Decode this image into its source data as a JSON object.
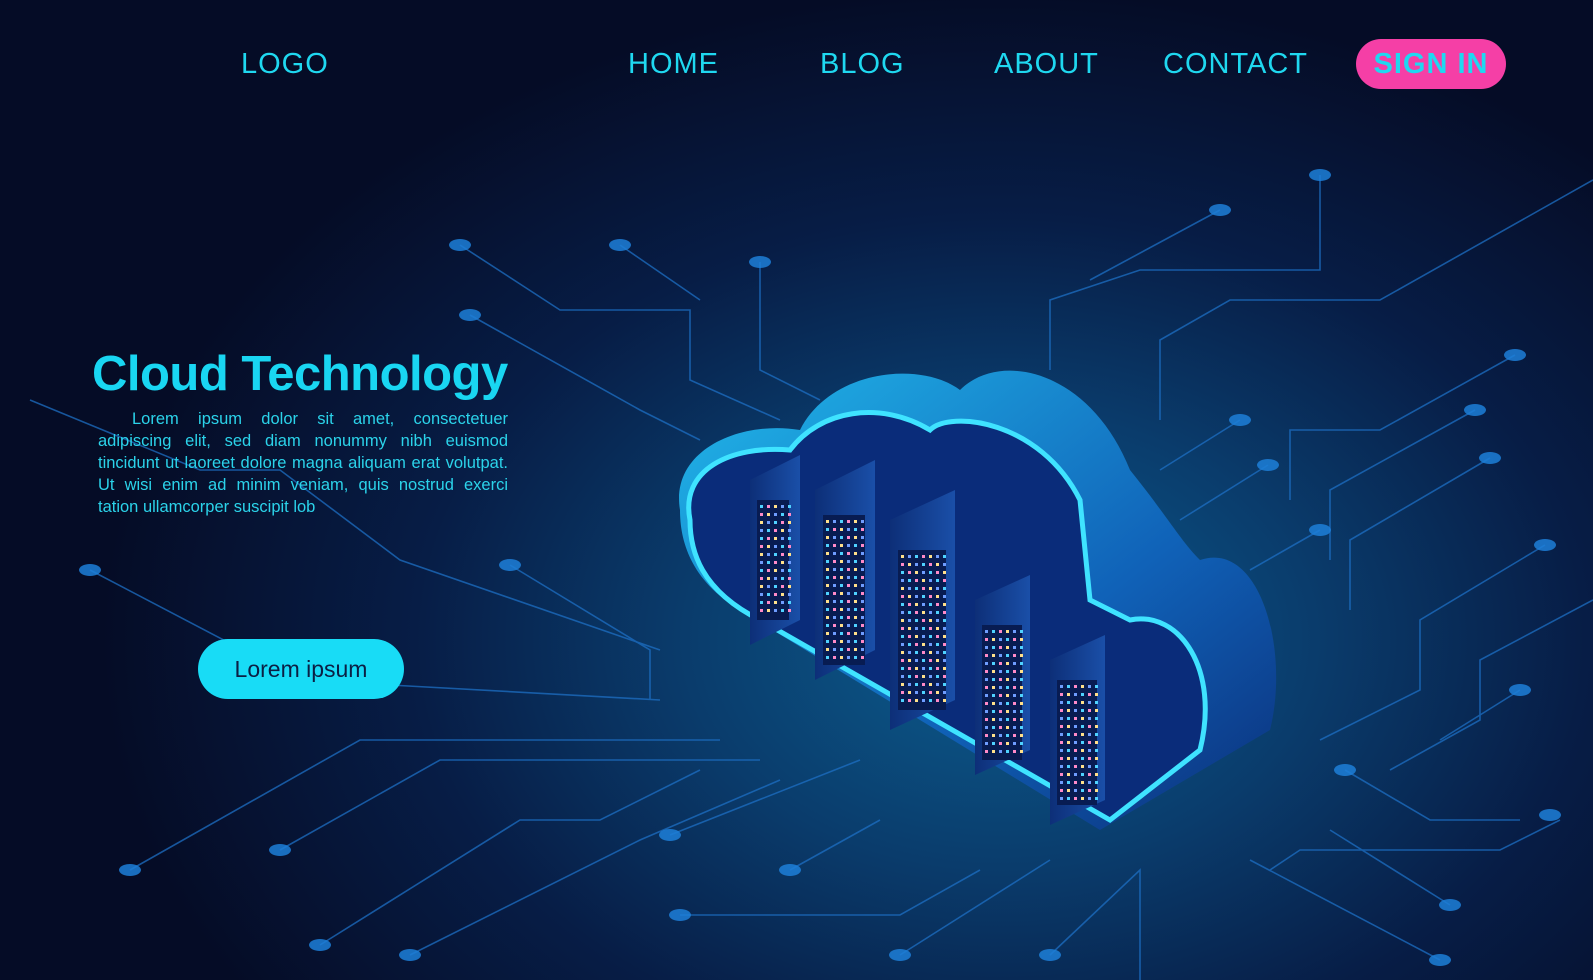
{
  "nav": {
    "logo": "LOGO",
    "items": [
      {
        "label": "HOME"
      },
      {
        "label": "BLOG"
      },
      {
        "label": "ABOUT"
      },
      {
        "label": "CONTACT"
      }
    ],
    "sign_in": "SIGN IN"
  },
  "hero": {
    "title": "Cloud Technology",
    "body": "Lorem ipsum dolor sit amet, consectetuer adipiscing elit, sed diam nonummy nibh euismod tincidunt ut laoreet dolore magna aliquam erat volutpat. Ut wisi enim ad minim veniam, quis nostrud exerci tation ullamcorper suscipit lob",
    "cta_label": "Lorem ipsum"
  },
  "illustration": {
    "subject": "isometric cloud containing server racks over circuit board",
    "server_count": 5
  },
  "colors": {
    "accent_cyan": "#1fd8f0",
    "sign_in_pink": "#f53fa6",
    "background_dark": "#050c26",
    "cta_text": "#0b1f44"
  }
}
